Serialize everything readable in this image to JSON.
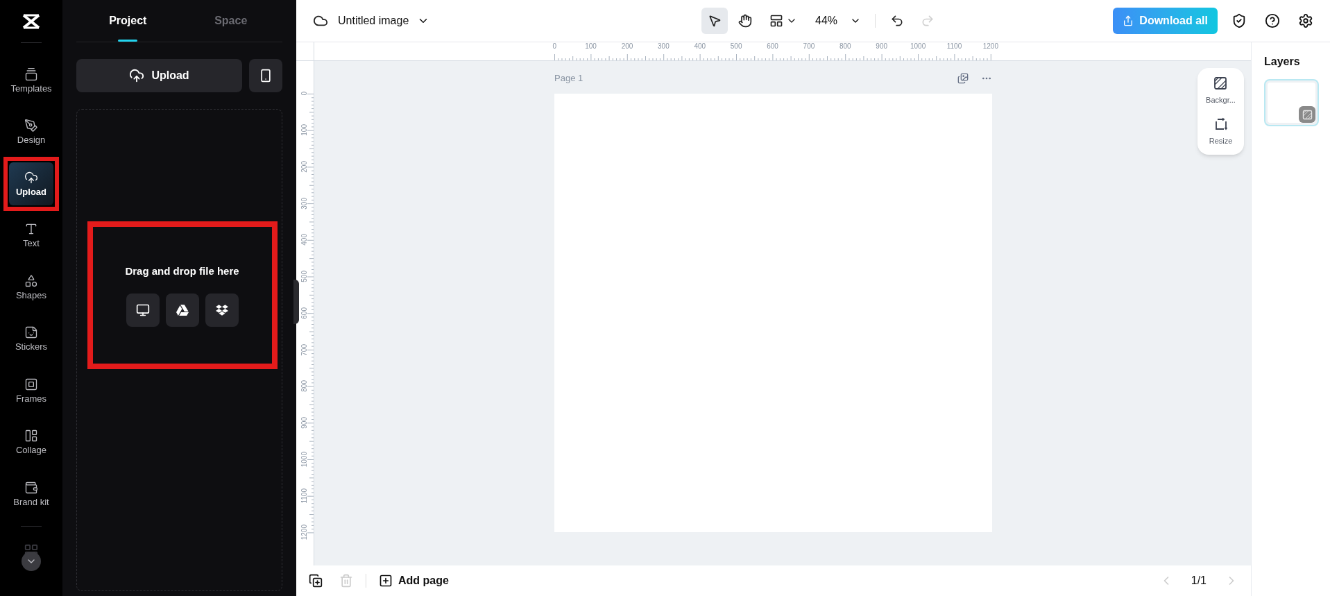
{
  "nav": {
    "items": [
      {
        "label": "Templates",
        "selected": false,
        "annotated": false
      },
      {
        "label": "Design",
        "selected": false,
        "annotated": false
      },
      {
        "label": "Upload",
        "selected": true,
        "annotated": true
      },
      {
        "label": "Text",
        "selected": false,
        "annotated": false
      },
      {
        "label": "Shapes",
        "selected": false,
        "annotated": false
      },
      {
        "label": "Stickers",
        "selected": false,
        "annotated": false
      },
      {
        "label": "Frames",
        "selected": false,
        "annotated": false
      },
      {
        "label": "Collage",
        "selected": false,
        "annotated": false
      },
      {
        "label": "Brand kit",
        "selected": false,
        "annotated": false
      }
    ]
  },
  "panel": {
    "tabs": [
      {
        "label": "Project",
        "selected": true
      },
      {
        "label": "Space",
        "selected": false
      }
    ],
    "upload_button": "Upload",
    "drop_zone": {
      "annotated": true,
      "text": "Drag and drop file here"
    }
  },
  "toolbar": {
    "title": "Untitled image",
    "tools": [
      {
        "kind": "pointer",
        "selected": true
      },
      {
        "kind": "hand",
        "selected": false
      }
    ],
    "zoom": "44%",
    "undo": {
      "disabled": false
    },
    "redo": {
      "disabled": true
    },
    "download_button": "Download all"
  },
  "rulers": {
    "horizontal": [
      "0",
      "100",
      "200",
      "300",
      "400",
      "500",
      "600",
      "700",
      "800",
      "900",
      "1000",
      "1100",
      "1200"
    ],
    "vertical": [
      "0",
      "100",
      "200",
      "300",
      "400",
      "500",
      "600",
      "700",
      "800",
      "900",
      "1000",
      "1100",
      "1200"
    ]
  },
  "canvas": {
    "page_label": "Page 1"
  },
  "side_tools": [
    {
      "kind": "background",
      "label": "Backgr..."
    },
    {
      "kind": "resize",
      "label": "Resize"
    }
  ],
  "layers": {
    "title": "Layers"
  },
  "bottom_bar": {
    "delete": {
      "disabled": true
    },
    "add_page": "Add page",
    "prev": {
      "disabled": true
    },
    "page_counter": "1/1",
    "next": {
      "disabled": true
    }
  }
}
